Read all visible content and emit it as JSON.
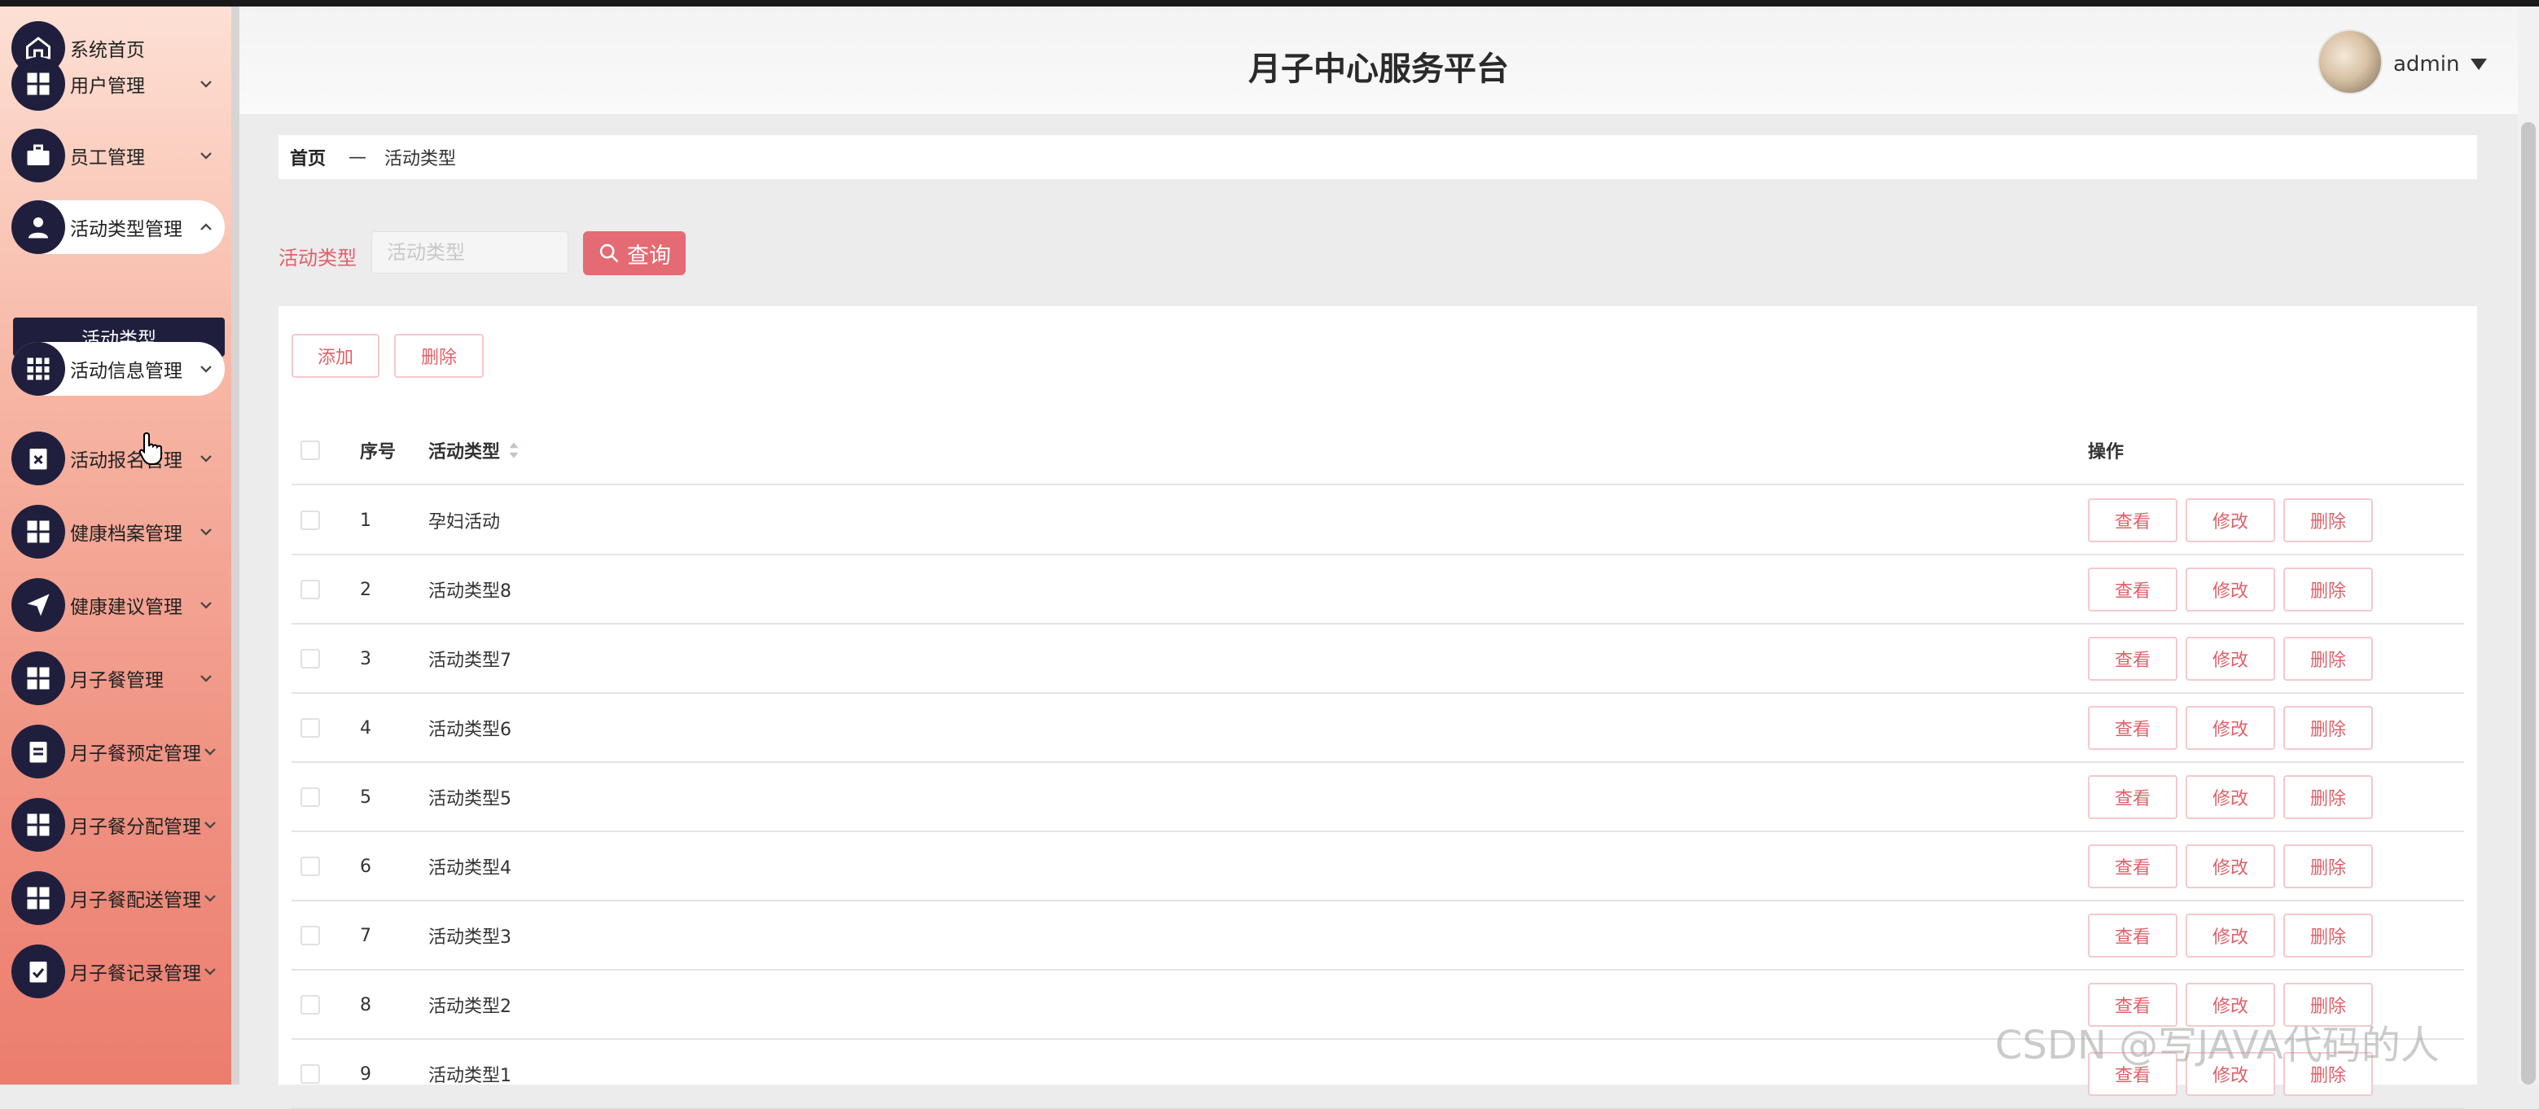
{
  "app": {
    "title": "月子中心服务平台",
    "user": "admin"
  },
  "sidebar": {
    "items": [
      {
        "label": "系统首页",
        "icon": "home-icon",
        "caret": false
      },
      {
        "label": "用户管理",
        "icon": "grid-icon",
        "caret": true
      },
      {
        "label": "员工管理",
        "icon": "briefcase-icon",
        "caret": true
      },
      {
        "label": "活动类型管理",
        "icon": "user-icon",
        "caret": true,
        "active": true
      },
      {
        "label": "活动信息管理",
        "icon": "apps-icon",
        "caret": true,
        "active": true
      },
      {
        "label": "活动报名管理",
        "icon": "clipboard-x-icon",
        "caret": true
      },
      {
        "label": "健康档案管理",
        "icon": "grid-icon",
        "caret": true
      },
      {
        "label": "健康建议管理",
        "icon": "send-icon",
        "caret": true
      },
      {
        "label": "月子餐管理",
        "icon": "grid-icon",
        "caret": true
      },
      {
        "label": "月子餐预定管理",
        "icon": "clipboard-icon",
        "caret": true
      },
      {
        "label": "月子餐分配管理",
        "icon": "grid-icon",
        "caret": true
      },
      {
        "label": "月子餐配送管理",
        "icon": "grid-icon",
        "caret": true
      },
      {
        "label": "月子餐记录管理",
        "icon": "clipboard-check-icon",
        "caret": true
      }
    ],
    "subitem": "活动类型"
  },
  "breadcrumb": {
    "home": "首页",
    "separator": "—",
    "current": "活动类型"
  },
  "search": {
    "label": "活动类型",
    "placeholder": "活动类型",
    "button": "查询"
  },
  "toolbar": {
    "add": "添加",
    "delete": "删除"
  },
  "table": {
    "headers": {
      "index": "序号",
      "name": "活动类型",
      "ops": "操作"
    },
    "rows": [
      {
        "index": "1",
        "name": "孕妇活动"
      },
      {
        "index": "2",
        "name": "活动类型8"
      },
      {
        "index": "3",
        "name": "活动类型7"
      },
      {
        "index": "4",
        "name": "活动类型6"
      },
      {
        "index": "5",
        "name": "活动类型5"
      },
      {
        "index": "6",
        "name": "活动类型4"
      },
      {
        "index": "7",
        "name": "活动类型3"
      },
      {
        "index": "8",
        "name": "活动类型2"
      },
      {
        "index": "9",
        "name": "活动类型1"
      }
    ],
    "row_actions": {
      "view": "查看",
      "edit": "修改",
      "delete": "删除"
    }
  },
  "watermark": "CSDN @写JAVA代码的人",
  "colors": {
    "accent": "#e46a73",
    "sidebar_dark": "#1f1f3d",
    "button_border": "#f4c9cc"
  }
}
